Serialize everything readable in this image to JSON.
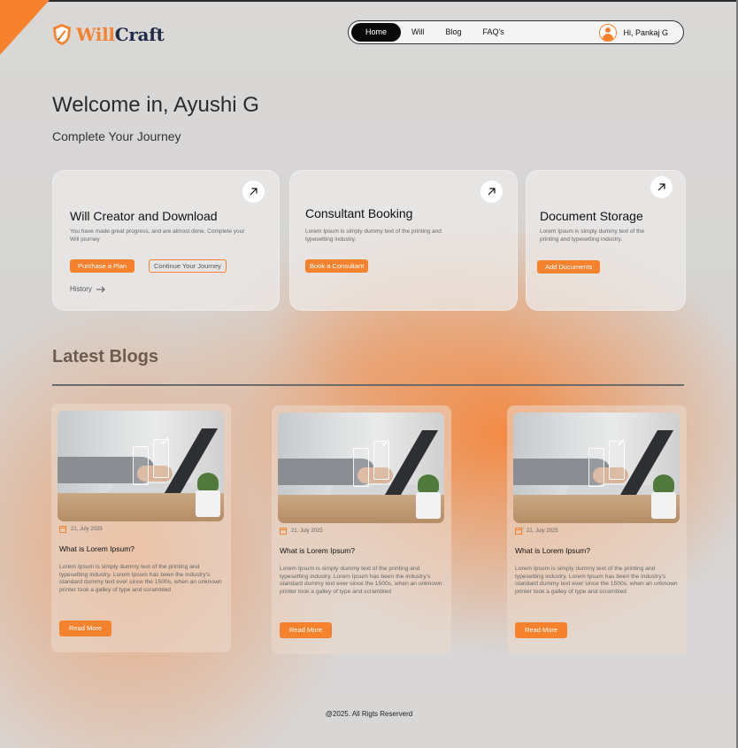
{
  "brand": {
    "name_part1": "Will",
    "name_part2": "Craft",
    "accent_color": "#f7822d",
    "dark_color": "#1f2a44",
    "icon": "shield-logo-icon"
  },
  "nav": {
    "items": [
      {
        "label": "Home",
        "active": true
      },
      {
        "label": "Will",
        "active": false
      },
      {
        "label": "Blog",
        "active": false
      },
      {
        "label": "FAQ's",
        "active": false
      }
    ],
    "user_greeting": "Hi, Pankaj G",
    "avatar_icon": "user-avatar-icon"
  },
  "welcome": {
    "title": "Welcome in, Ayushi G",
    "subtitle": "Complete Your Journey"
  },
  "cards": [
    {
      "title": "Will Creator and Download",
      "description": "You have made great progress, and are almost done. Complete your Will journey",
      "primary_button": "Purchase a Plan",
      "secondary_button": "Continue Your Journey",
      "history_label": "History",
      "arrow_icon": "arrow-up-right-icon"
    },
    {
      "title": "Consultant Booking",
      "description": "Lorem Ipsum is simply dummy text of the printing and typesetting industry.",
      "primary_button": "Book a Consultant",
      "arrow_icon": "arrow-up-right-icon"
    },
    {
      "title": "Document Storage",
      "description": "Lorem Ipsum is simply dummy text of the printing and typesetting industry.",
      "primary_button": "Add Documents",
      "arrow_icon": "arrow-up-right-icon"
    }
  ],
  "blogs": {
    "section_title": "Latest Blogs",
    "posts": [
      {
        "date": "21, July 2025",
        "title": "What is Lorem Ipsum?",
        "excerpt": "Lorem Ipsum is simply dummy text of the printing and typesetting industry. Lorem Ipsum has been the industry's standard dummy text ever since the 1500s, when an unknown printer took a galley of type and scrambled",
        "button": "Read More"
      },
      {
        "date": "21, July 2025",
        "title": "What is Lorem Ipsum?",
        "excerpt": "Lorem Ipsum is simply dummy text of the printing and typesetting industry. Lorem Ipsum has been the industry's standard dummy text ever since the 1500s, when an unknown printer took a galley of type and scrambled",
        "button": "Read More"
      },
      {
        "date": "21, July 2025",
        "title": "What is Lorem Ipsum?",
        "excerpt": "Lorem Ipsum is simply dummy text of the printing and typesetting industry. Lorem Ipsum has been the industry's standard dummy text ever since the 1500s, when an unknown printer took a galley of type and scrambled",
        "button": "Read More"
      }
    ]
  },
  "footer": {
    "text": "@2025. All Rigts Reserverd"
  }
}
